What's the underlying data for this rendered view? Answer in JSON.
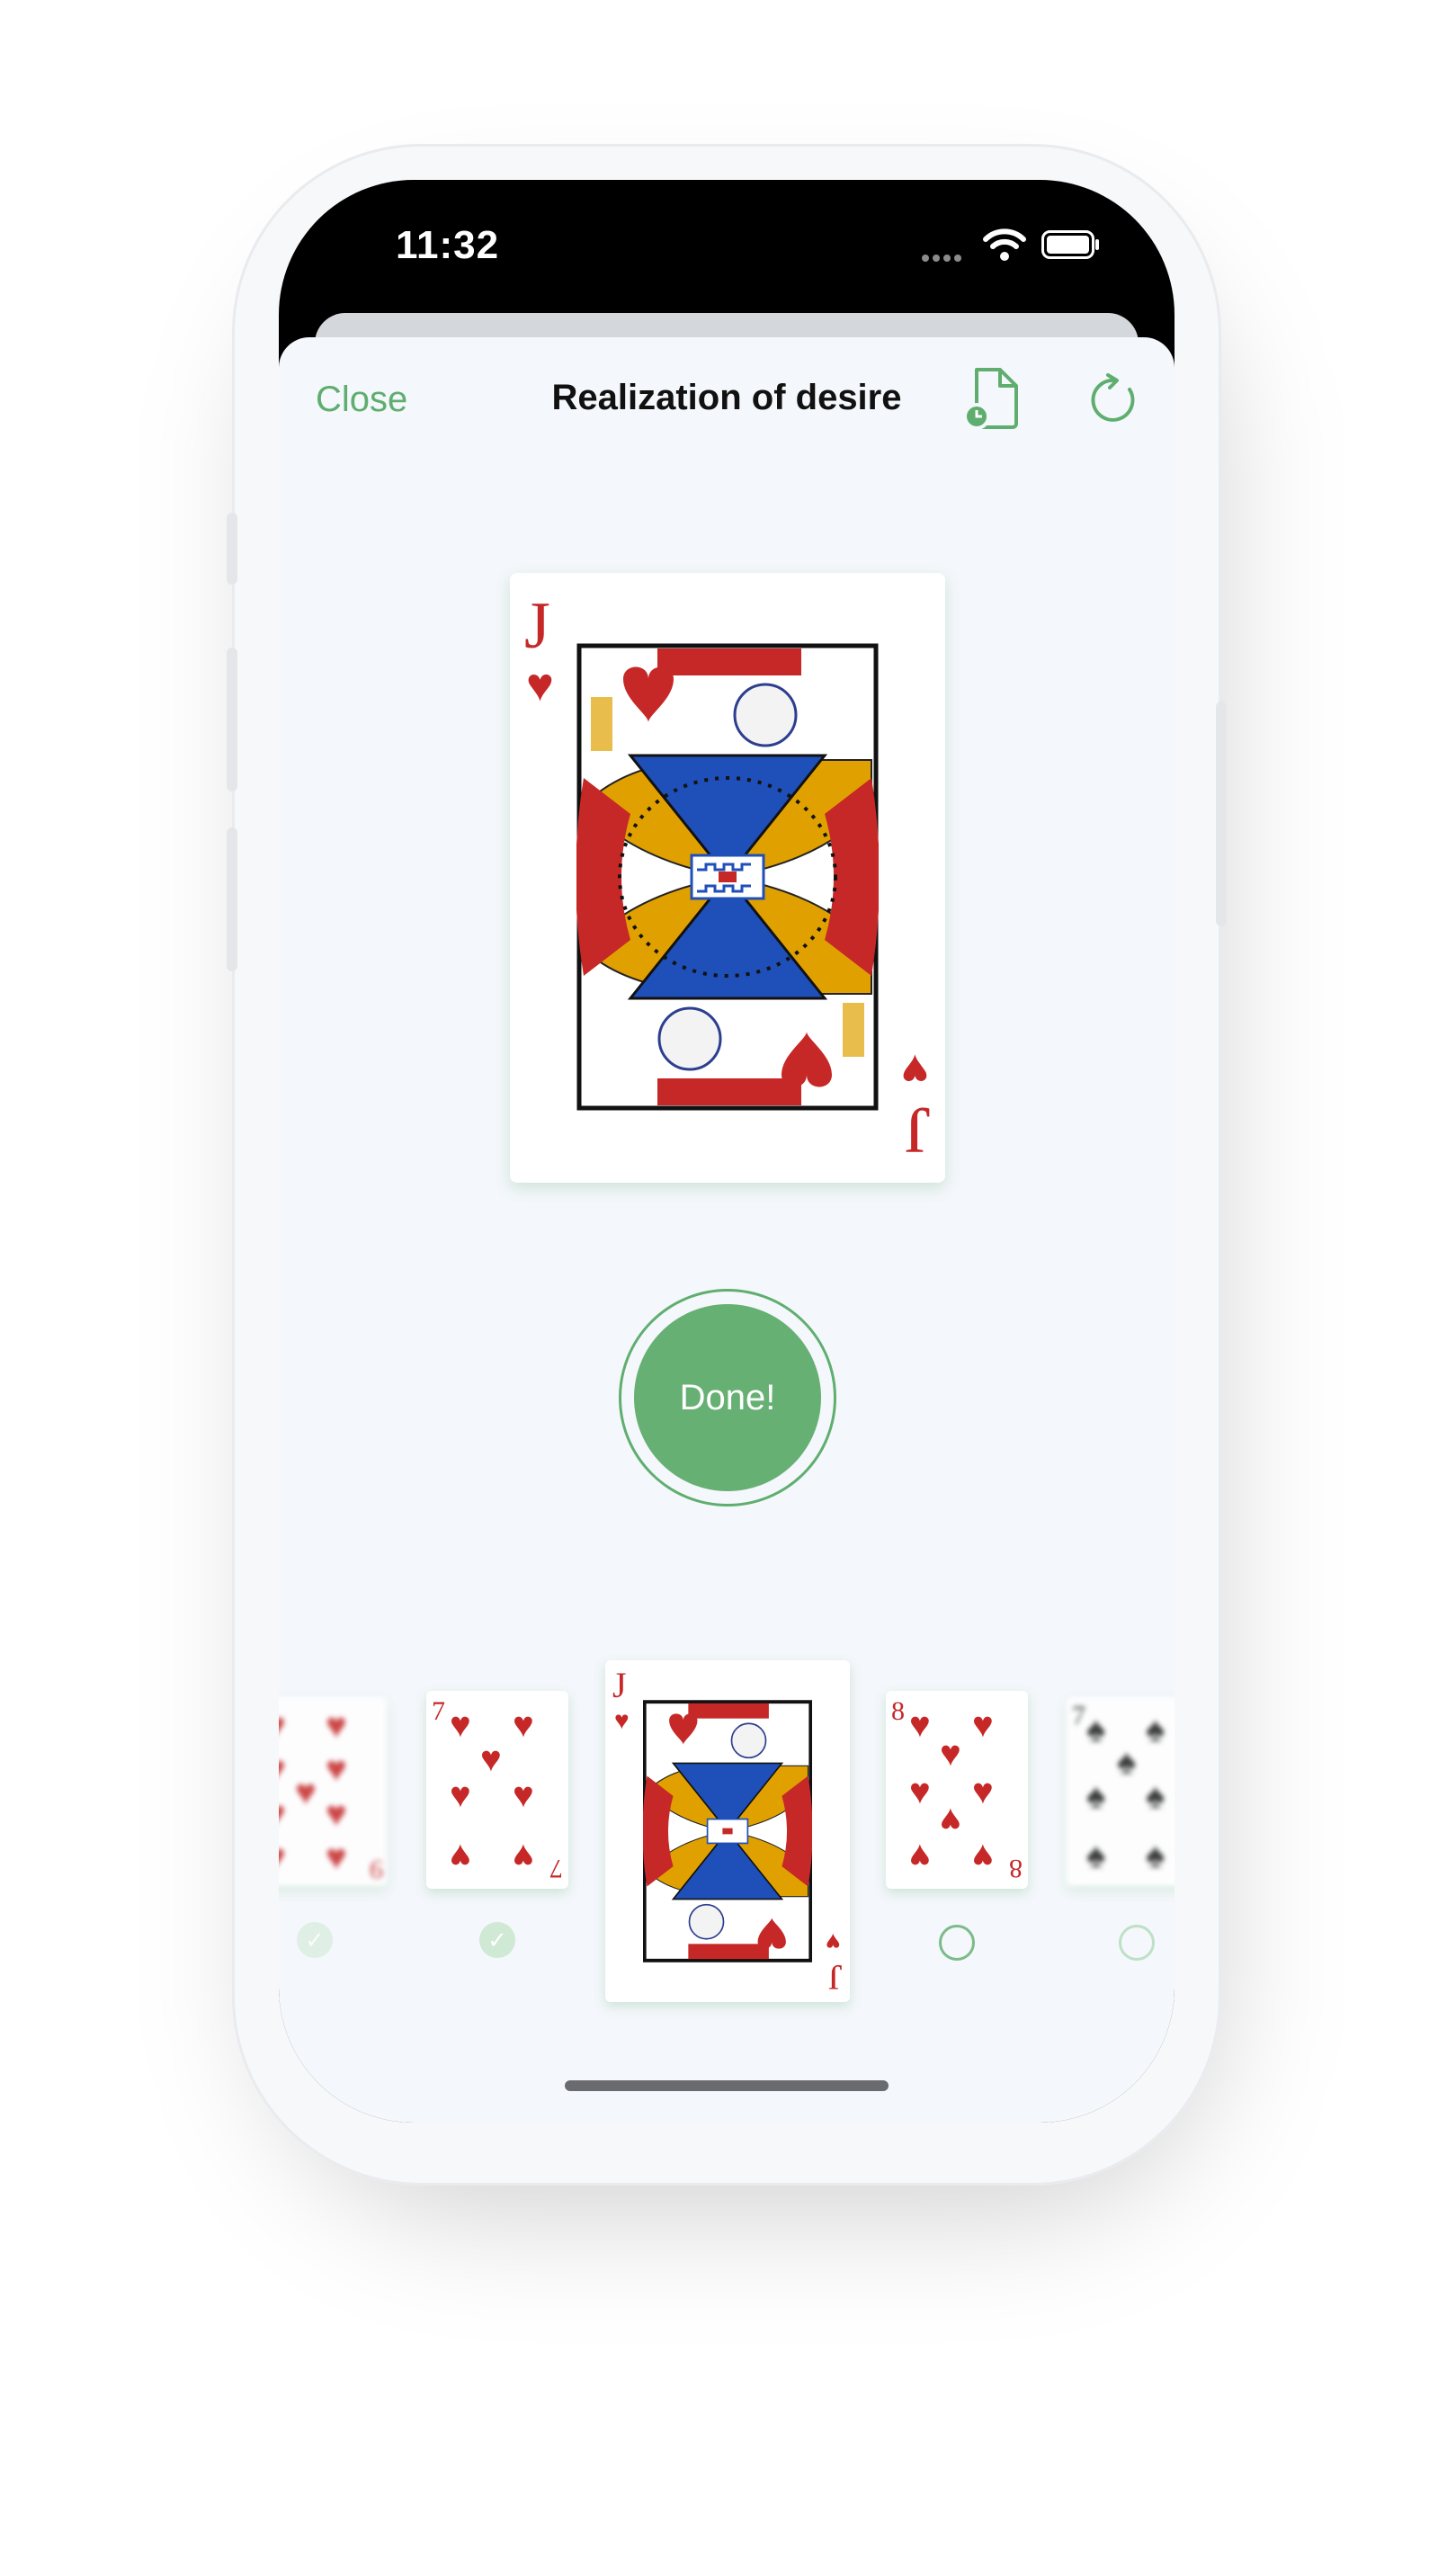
{
  "status_bar": {
    "time": "11:32"
  },
  "nav": {
    "close_label": "Close",
    "title": "Realization of desire",
    "history_icon": "document-clock-icon",
    "refresh_icon": "refresh-icon"
  },
  "current_card": {
    "rank": "J",
    "suit": "♥"
  },
  "done_button": {
    "label": "Done!"
  },
  "carousel": [
    {
      "rank": "9",
      "suit": "♥",
      "status": "done"
    },
    {
      "rank": "7",
      "suit": "♥",
      "status": "done"
    },
    {
      "rank": "J",
      "suit": "♥",
      "status": "current"
    },
    {
      "rank": "8",
      "suit": "♥",
      "status": "pending"
    },
    {
      "rank": "7",
      "suit": "♠",
      "status": "pending"
    }
  ],
  "colors": {
    "accent": "#66b073",
    "heart": "#c62828",
    "spade": "#1a1a1a",
    "sheet_bg": "#f4f7fb"
  }
}
